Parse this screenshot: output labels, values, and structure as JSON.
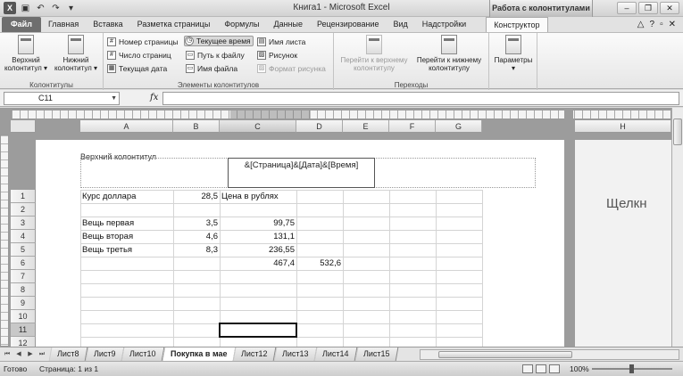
{
  "titlebar": {
    "title": "Книга1 - Microsoft Excel",
    "contextual_group": "Работа с колонтитулами",
    "excel_glyph": "X",
    "qat": [
      "save-icon",
      "undo-icon",
      "redo-icon",
      "dropdown-icon"
    ],
    "window_buttons": [
      "minimize-icon",
      "restore-icon",
      "close-icon"
    ]
  },
  "tabs": [
    {
      "label": "Файл"
    },
    {
      "label": "Главная"
    },
    {
      "label": "Вставка"
    },
    {
      "label": "Разметка страницы"
    },
    {
      "label": "Формулы"
    },
    {
      "label": "Данные"
    },
    {
      "label": "Рецензирование"
    },
    {
      "label": "Вид"
    },
    {
      "label": "Надстройки"
    },
    {
      "label": "Конструктор"
    }
  ],
  "ribbon": {
    "group_kolontituly": {
      "label": "Колонтитулы",
      "header_button": "Верхний колонтитул ▾",
      "footer_button": "Нижний колонтитул ▾"
    },
    "group_elements": {
      "label": "Элементы колонтитулов",
      "page_number": "Номер страницы",
      "page_count": "Число страниц",
      "current_date": "Текущая дата",
      "current_time": "Текущее время",
      "file_path": "Путь к файлу",
      "file_name": "Имя файла",
      "sheet_name": "Имя листа",
      "picture": "Рисунок",
      "picture_format": "Формат рисунка"
    },
    "group_transitions": {
      "label": "Переходы",
      "goto_header": "Перейти к верхнему колонтитулу",
      "goto_footer": "Перейти к нижнему колонтитулу"
    },
    "group_params": {
      "label": "Параметры"
    }
  },
  "formula_bar": {
    "name_box": "C11",
    "fx": "fx",
    "value": ""
  },
  "columns": [
    "A",
    "B",
    "C",
    "D",
    "E",
    "F",
    "G",
    "H"
  ],
  "rows": [
    "1",
    "2",
    "3",
    "4",
    "5",
    "6",
    "7",
    "8",
    "9",
    "10",
    "11",
    "12"
  ],
  "page": {
    "header_label": "Верхний колонтитул",
    "header_center": "&[Страница]&[Дата]&[Время]",
    "next_page_text": "Щелкн"
  },
  "cells": {
    "A1": "Курс доллара",
    "B1": "28,5",
    "C1": "Цена в рублях",
    "A3": "Вещь первая",
    "B3": "3,5",
    "C3": "99,75",
    "A4": "Вещь вторая",
    "B4": "4,6",
    "C4": "131,1",
    "A5": "Вещь третья",
    "B5": "8,3",
    "C5": "236,55",
    "C6": "467,4",
    "D6": "532,6"
  },
  "sheet_tabs": [
    "Лист8",
    "Лист9",
    "Лист10",
    "Покупка в мае",
    "Лист12",
    "Лист13",
    "Лист14",
    "Лист15"
  ],
  "status": {
    "ready": "Готово",
    "page_info": "Страница: 1 из 1",
    "zoom": "100%"
  }
}
